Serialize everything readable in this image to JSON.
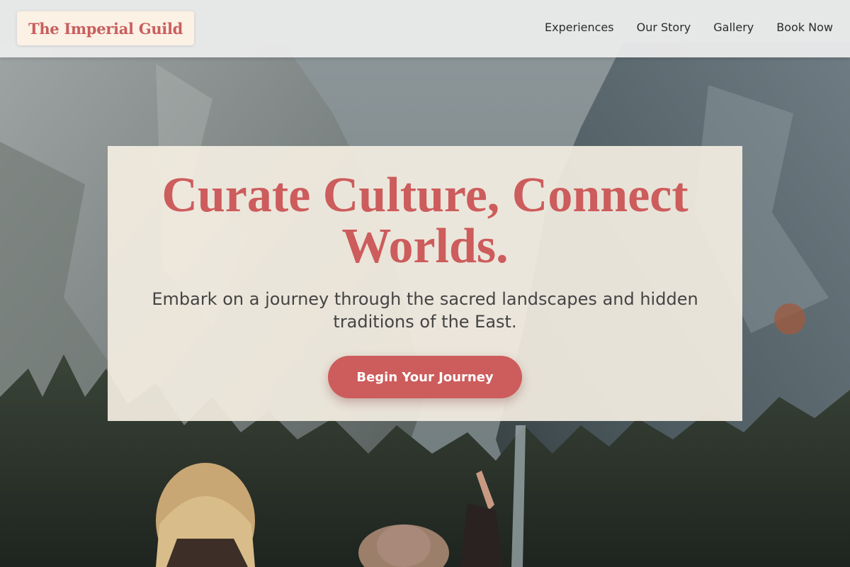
{
  "header": {
    "logo_text": "The Imperial Guild",
    "nav": [
      {
        "label": "Experiences"
      },
      {
        "label": "Our Story"
      },
      {
        "label": "Gallery"
      },
      {
        "label": "Book Now"
      }
    ]
  },
  "hero": {
    "title": "Curate Culture, Connect Worlds.",
    "subtitle": "Embark on a journey through the sacred landscapes and hidden traditions of the East.",
    "cta_label": "Begin Your Journey"
  },
  "colors": {
    "accent": "#cd5c5c",
    "nav_background": "#ececec",
    "card_background": "#f4eee2",
    "logo_background": "#fbf1e4"
  }
}
